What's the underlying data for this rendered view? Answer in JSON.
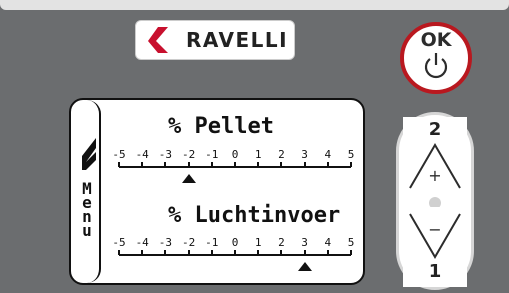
{
  "brand": {
    "name": "RAVELLI",
    "color": "#c8102e"
  },
  "ok_button": {
    "label": "OK",
    "icon": "power-icon",
    "ring_color": "#b9181f"
  },
  "screen": {
    "menu_label": [
      "M",
      "e",
      "n",
      "u"
    ],
    "menu_icon": "flame-icon",
    "gauges": [
      {
        "title": "% Pellet",
        "scale": [
          "-5",
          "-4",
          "-3",
          "-2",
          "-1",
          "0",
          "1",
          "2",
          "3",
          "4",
          "5"
        ],
        "value": -2
      },
      {
        "title": "% Luchtinvoer",
        "scale": [
          "-5",
          "-4",
          "-3",
          "-2",
          "-1",
          "0",
          "1",
          "2",
          "3",
          "4",
          "5"
        ],
        "value": 3
      }
    ]
  },
  "nav": {
    "up": {
      "number": "2",
      "symbol": "+"
    },
    "down": {
      "number": "1",
      "symbol": "−"
    }
  }
}
